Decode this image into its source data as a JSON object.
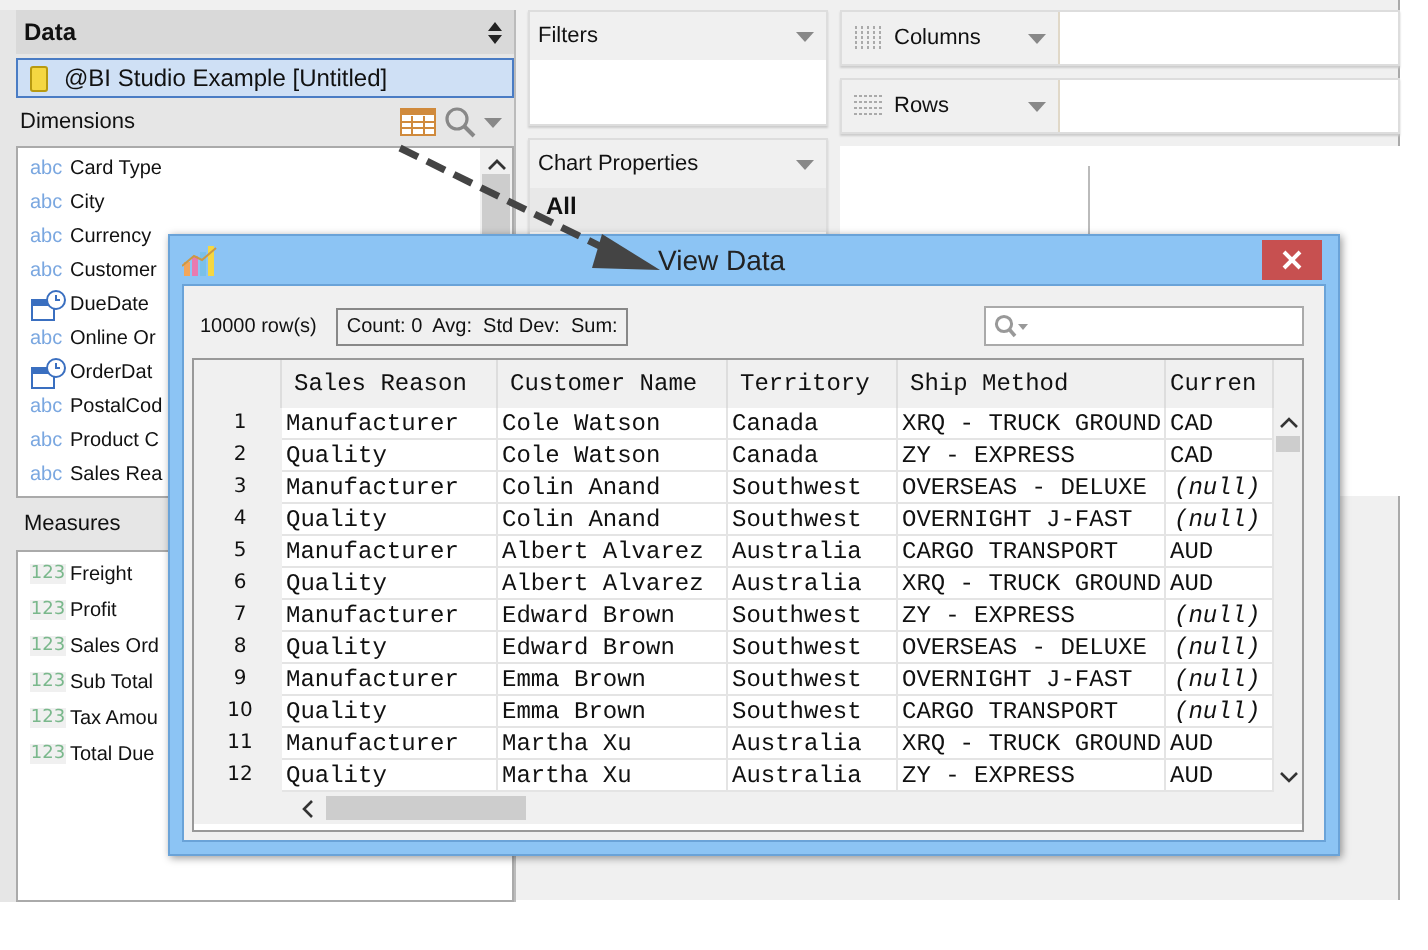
{
  "data_panel": {
    "title": "Data",
    "source": {
      "label": "@BI Studio Example [Untitled]",
      "selected": true
    }
  },
  "dimensions": {
    "title": "Dimensions",
    "items": [
      {
        "kind": "text",
        "badge": "abc",
        "label": "Card Type"
      },
      {
        "kind": "text",
        "badge": "abc",
        "label": "City"
      },
      {
        "kind": "text",
        "badge": "abc",
        "label": "Currency"
      },
      {
        "kind": "text",
        "badge": "abc",
        "label": "Customer"
      },
      {
        "kind": "date",
        "label": "DueDate"
      },
      {
        "kind": "text",
        "badge": "abc",
        "label": "Online Or"
      },
      {
        "kind": "date",
        "label": "OrderDat"
      },
      {
        "kind": "text",
        "badge": "abc",
        "label": "PostalCod"
      },
      {
        "kind": "text",
        "badge": "abc",
        "label": "Product C"
      },
      {
        "kind": "text",
        "badge": "abc",
        "label": "Sales Rea"
      }
    ]
  },
  "measures": {
    "title": "Measures",
    "items": [
      {
        "badge": "123",
        "label": "Freight"
      },
      {
        "badge": "123",
        "label": "Profit"
      },
      {
        "badge": "123",
        "label": "Sales Ord"
      },
      {
        "badge": "123",
        "label": "Sub Total"
      },
      {
        "badge": "123",
        "label": "Tax Amou"
      },
      {
        "badge": "123",
        "label": "Total Due"
      }
    ]
  },
  "filters": {
    "title": "Filters"
  },
  "chart_properties": {
    "title": "Chart Properties",
    "section": "All"
  },
  "shelves": [
    {
      "kind": "columns",
      "label": "Columns"
    },
    {
      "kind": "rows",
      "label": "Rows"
    }
  ],
  "dialog": {
    "title": "View Data",
    "row_count": "10000 row(s)",
    "stats": "Count: 0  Avg:  Std Dev:  Sum:",
    "columns": [
      "Sales Reason",
      "Customer Name",
      "Territory",
      "Ship Method",
      "Curren"
    ],
    "rows": [
      {
        "number": "1",
        "cells": [
          "Manufacturer",
          "Cole Watson",
          "Canada",
          "XRQ - TRUCK GROUND"
        ],
        "currency": {
          "text": "CAD",
          "kind": "value"
        }
      },
      {
        "number": "2",
        "cells": [
          "Quality",
          "Cole Watson",
          "Canada",
          "ZY - EXPRESS"
        ],
        "currency": {
          "text": "CAD",
          "kind": "value"
        }
      },
      {
        "number": "3",
        "cells": [
          "Manufacturer",
          "Colin Anand",
          "Southwest",
          "OVERSEAS - DELUXE"
        ],
        "currency": {
          "text": "(null)",
          "kind": "null"
        }
      },
      {
        "number": "4",
        "cells": [
          "Quality",
          "Colin Anand",
          "Southwest",
          "OVERNIGHT J-FAST"
        ],
        "currency": {
          "text": "(null)",
          "kind": "null"
        }
      },
      {
        "number": "5",
        "cells": [
          "Manufacturer",
          "Albert Alvarez",
          "Australia",
          "CARGO TRANSPORT"
        ],
        "currency": {
          "text": "AUD",
          "kind": "value"
        }
      },
      {
        "number": "6",
        "cells": [
          "Quality",
          "Albert Alvarez",
          "Australia",
          "XRQ - TRUCK GROUND"
        ],
        "currency": {
          "text": "AUD",
          "kind": "value"
        }
      },
      {
        "number": "7",
        "cells": [
          "Manufacturer",
          "Edward Brown",
          "Southwest",
          "ZY - EXPRESS"
        ],
        "currency": {
          "text": "(null)",
          "kind": "null"
        }
      },
      {
        "number": "8",
        "cells": [
          "Quality",
          "Edward Brown",
          "Southwest",
          "OVERSEAS - DELUXE"
        ],
        "currency": {
          "text": "(null)",
          "kind": "null"
        }
      },
      {
        "number": "9",
        "cells": [
          "Manufacturer",
          "Emma Brown",
          "Southwest",
          "OVERNIGHT J-FAST"
        ],
        "currency": {
          "text": "(null)",
          "kind": "null"
        }
      },
      {
        "number": "10",
        "cells": [
          "Quality",
          "Emma Brown",
          "Southwest",
          "CARGO TRANSPORT"
        ],
        "currency": {
          "text": "(null)",
          "kind": "null"
        }
      },
      {
        "number": "11",
        "cells": [
          "Manufacturer",
          "Martha Xu",
          "Australia",
          "XRQ - TRUCK GROUND"
        ],
        "currency": {
          "text": "AUD",
          "kind": "value"
        }
      },
      {
        "number": "12",
        "cells": [
          "Quality",
          "Martha Xu",
          "Australia",
          "ZY - EXPRESS"
        ],
        "currency": {
          "text": "AUD",
          "kind": "value"
        }
      }
    ]
  }
}
